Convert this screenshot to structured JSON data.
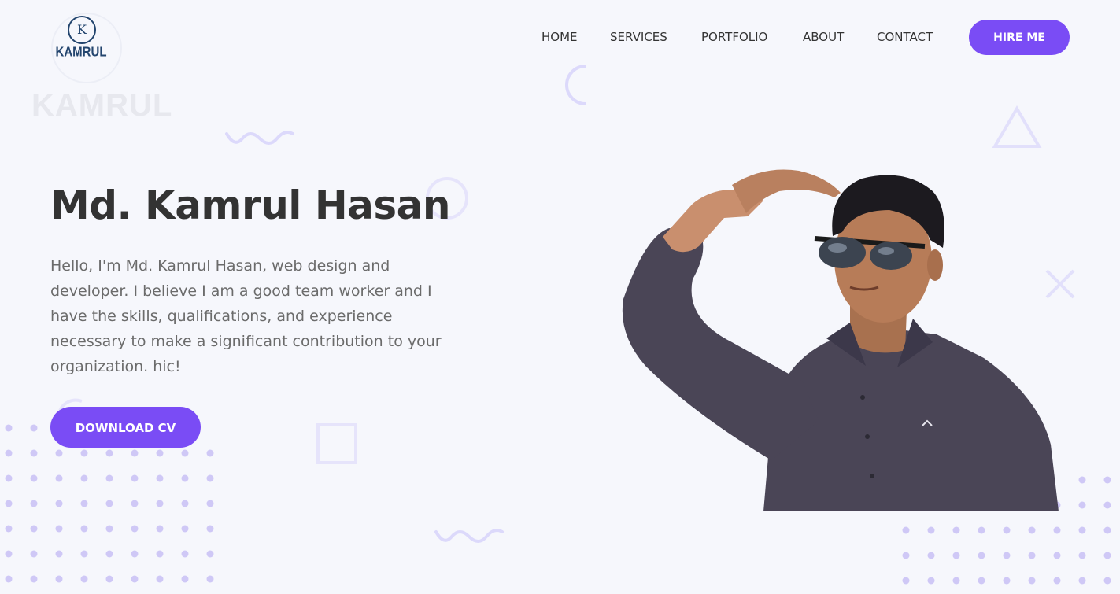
{
  "logo": {
    "letter": "K",
    "name": "KAMRUL",
    "watermark": "KAMRUL"
  },
  "nav": {
    "items": [
      {
        "label": "HOME"
      },
      {
        "label": "SERVICES"
      },
      {
        "label": "PORTFOLIO"
      },
      {
        "label": "ABOUT"
      },
      {
        "label": "CONTACT"
      }
    ],
    "hire_label": "HIRE ME"
  },
  "hero": {
    "title": "Md. Kamrul Hasan",
    "intro": "Hello, I'm Md. Kamrul Hasan, web design and developer. I believe I am a good team worker and I have the skills, qualifications, and experience necessary to make a significant contribution to your organization. hic!",
    "download_label": "DOWNLOAD CV"
  },
  "colors": {
    "accent": "#7a4cf5",
    "background": "#f6f7fc",
    "heading": "#333333",
    "body_text": "#6b6b6b",
    "decoration": "#dcd9fb",
    "dot": "#cfc8f6"
  },
  "icons": {
    "portrait": "person-portrait",
    "shapes": [
      "circle-arc-shape",
      "wave-shape",
      "triangle-shape",
      "cross-shape",
      "square-shape",
      "circle-shape"
    ]
  }
}
